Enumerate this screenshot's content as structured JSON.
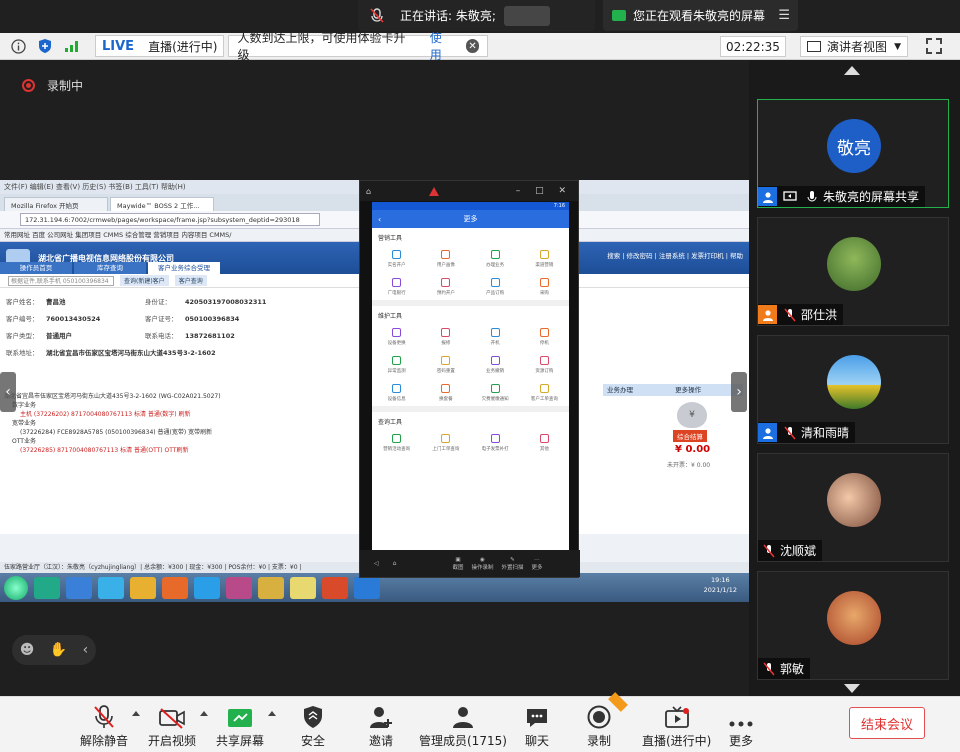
{
  "top": {
    "speaking_label": "正在讲话: 朱敬亮;",
    "viewing_label": "您正在观看朱敬亮的屏幕",
    "viewing_menu_icon": "menu-icon"
  },
  "status_bar": {
    "live_tag": "LIVE",
    "live_state": "直播(进行中)",
    "limit_text": "人数到达上限，可使用体验卡升级",
    "limit_action": "使用",
    "timer": "02:22:35",
    "view_mode": "演讲者视图"
  },
  "recording": {
    "label": "录制中"
  },
  "desktop": {
    "ff_title": "文件(F)  编辑(E)  查看(V)  历史(S)  书签(B)  工具(T)  帮助(H)",
    "ff_menu": "Mozilla Firefox 开始页",
    "tabs": [
      "Mozilla Firefox 开始页",
      "Maywide™ BOSS 2 工作..."
    ],
    "url": "172.31.194.6:7002/crmweb/pages/workspace/frame.jsp?subsystem_deptid=293018",
    "bookmarks": "常用网址  百度  公司网址  集团项目  CMMS  综合管理  营销项目  内容项目  CMMS/",
    "boss_title": "湖北省广播电视信息网络股份有限公司",
    "boss_nav": [
      "操作员首页",
      "库存查询",
      "客户业务综合受理"
    ],
    "boss_right": "搜索 | 修改密码 | 注册系统 | 发票打印机 | 帮助",
    "search_placeholder": "根据证件,联系手机 050100396834",
    "search_tabs": [
      "查询(新建)客户",
      "客户查询"
    ],
    "cust": {
      "name_k": "客户姓名：",
      "name_v": "曹昌池",
      "code_k": "客户编号：",
      "code_v": "760013430524",
      "type_k": "客户类型：",
      "type_v": "普通用户",
      "addr_k": "联系地址：",
      "addr_v": "湖北省宜昌市伍家区宝塔河马街东山大道435号3-2-1602",
      "id_k": "身份证：",
      "id_v": "420503197008032311",
      "cert_k": "客户证号：",
      "cert_v": "050100396834",
      "phone_k": "联系电话：",
      "phone_v": "13872681102"
    },
    "tree": [
      "湖北省宜昌市伍家区宝塔河马街东山大道435号3-2-1602 (WG-C02A021.5027)",
      "数字业务",
      "主机 (37226202) 8717004080767113 标清 普通(数字) 刷新",
      "宽带业务",
      "(37226284) FCE8928A5785 (050100396834) 普通(宽带) 宽带刷新",
      "OTT业务",
      "(37226285) 8717004080767113 标清 普通(OTT) OTT刷新"
    ],
    "panel_tab": "业务办理",
    "more_ops": "更多操作",
    "settle_tag": "综合结算",
    "amount": "¥ 0.00",
    "unpaid": "未开票：¥ 0.00",
    "footer_text": "伍家路营业厅（江汉）：朱敬亮（cyzhujingliang）| 总余额：¥300 | 现金：¥300 | POS余付：¥0 | 支票：¥0 |",
    "clock_time": "19:16",
    "clock_date": "2021/1/12"
  },
  "phone": {
    "title": "更多",
    "status_time": "7:16",
    "sections": [
      {
        "title": "营销工具",
        "items": [
          "实名开户",
          "用户画像",
          "办理业务",
          "渠道营销",
          "广电银行",
          "预约开户",
          "产品订购",
          "采购"
        ]
      },
      {
        "title": "维护工具",
        "items": [
          "设备更换",
          "报修",
          "开机",
          "停机",
          "异常监测",
          "密码重置",
          "业务撤销",
          "资源订购",
          "设备信息",
          "换套餐",
          "欠费催缴通知",
          "客户工单查询"
        ]
      },
      {
        "title": "查询工具",
        "items": [
          "营销活动查询",
          "上门工单查询",
          "电子发票补打",
          "其他"
        ]
      }
    ],
    "nav_tools": [
      "截图",
      "操作录制",
      "外置扫描",
      "更多"
    ]
  },
  "gallery": [
    {
      "name": "朱敬亮的屏幕共享",
      "avatar_text": "敬亮",
      "active": true
    },
    {
      "name": "邵仕洪",
      "avatar_text": "",
      "active": false
    },
    {
      "name": "清和雨晴",
      "avatar_text": "",
      "active": false
    },
    {
      "name": "沈顺斌",
      "avatar_text": "",
      "active": false
    },
    {
      "name": "郭敏",
      "avatar_text": "",
      "active": false
    }
  ],
  "toolbar": {
    "unmute": "解除静音",
    "video": "开启视频",
    "share": "共享屏幕",
    "security": "安全",
    "invite": "邀请",
    "participants": "管理成员(1715)",
    "chat": "聊天",
    "record": "录制",
    "live": "直播(进行中)",
    "more": "更多",
    "end": "结束会议"
  },
  "colors": {
    "accent_green": "#23b14d",
    "live_blue": "#1a66cc",
    "end_red": "#e03030"
  }
}
